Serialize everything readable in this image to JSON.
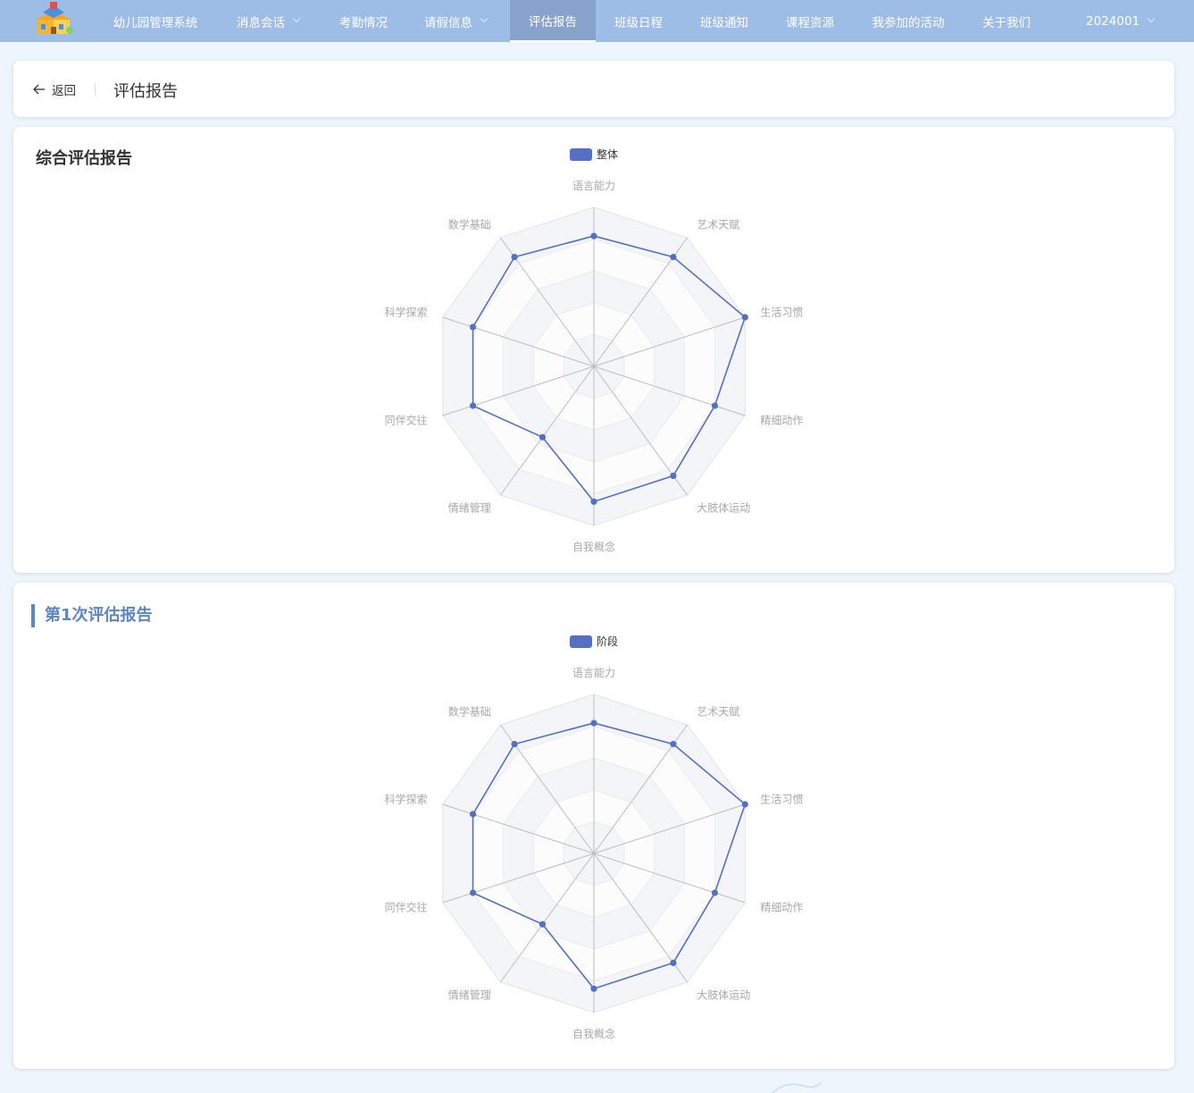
{
  "nav": {
    "items": [
      {
        "label": "幼儿园管理系统",
        "dropdown": false,
        "active": false
      },
      {
        "label": "消息会话",
        "dropdown": true,
        "active": false
      },
      {
        "label": "考勤情况",
        "dropdown": false,
        "active": false
      },
      {
        "label": "请假信息",
        "dropdown": true,
        "active": false
      },
      {
        "label": "评估报告",
        "dropdown": false,
        "active": true
      },
      {
        "label": "班级日程",
        "dropdown": false,
        "active": false
      },
      {
        "label": "班级通知",
        "dropdown": false,
        "active": false
      },
      {
        "label": "课程资源",
        "dropdown": false,
        "active": false
      },
      {
        "label": "我参加的活动",
        "dropdown": false,
        "active": false
      },
      {
        "label": "关于我们",
        "dropdown": false,
        "active": false
      }
    ],
    "user": "2024001"
  },
  "header": {
    "back_label": "返回",
    "title": "评估报告"
  },
  "colors": {
    "nav_bg": "#9dbde6",
    "nav_active": "#87a3cb",
    "series": "#5470c6",
    "section_accent": "#5d86c4"
  },
  "sections": [
    {
      "title": "综合评估报告"
    },
    {
      "title": "第1次评估报告"
    }
  ],
  "chart_data": [
    {
      "type": "radar",
      "series_name": "整体",
      "indicators": [
        "语言能力",
        "艺术天赋",
        "生活习惯",
        "精细动作",
        "大肢体运动",
        "自我概念",
        "情绪管理",
        "同伴交往",
        "科学探索",
        "数学基础"
      ],
      "max": 100,
      "values": [
        82,
        85,
        100,
        80,
        85,
        85,
        55,
        80,
        80,
        85
      ]
    },
    {
      "type": "radar",
      "series_name": "阶段",
      "indicators": [
        "语言能力",
        "艺术天赋",
        "生活习惯",
        "精细动作",
        "大肢体运动",
        "自我概念",
        "情绪管理",
        "同伴交往",
        "科学探索",
        "数学基础"
      ],
      "max": 100,
      "values": [
        82,
        85,
        100,
        80,
        85,
        85,
        55,
        80,
        80,
        85
      ]
    }
  ]
}
